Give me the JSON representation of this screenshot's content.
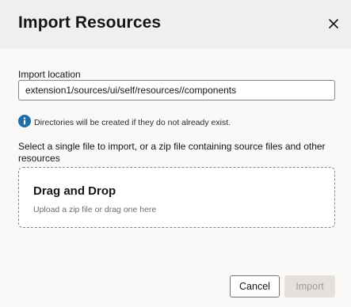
{
  "dialog": {
    "title": "Import Resources"
  },
  "import_location": {
    "label": "Import location",
    "value": "extension1/sources/ui/self/resources//components"
  },
  "info": {
    "icon": "info-icon",
    "text": "Directories will be created if they do not already exist."
  },
  "instructions": "Select a single file to import, or a zip file containing source files and other resources",
  "dropzone": {
    "title": "Drag and Drop",
    "subtitle": "Upload a zip file or drag one here"
  },
  "footer": {
    "cancel_label": "Cancel",
    "import_label": "Import"
  },
  "colors": {
    "header_bg": "#f1efed",
    "body_bg": "#fbf9f8",
    "info_blue": "#1f6ea8",
    "disabled_button_bg": "#e4e1dd"
  }
}
